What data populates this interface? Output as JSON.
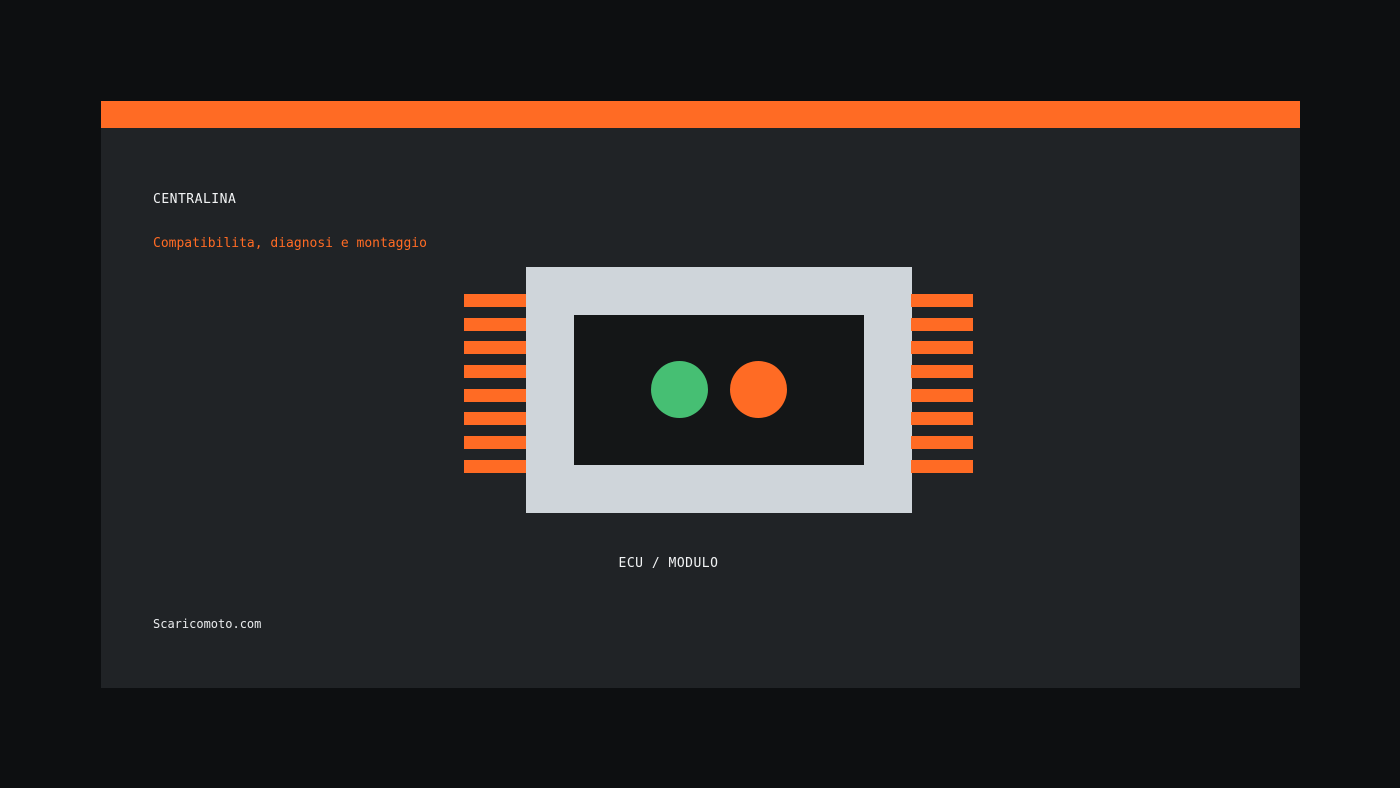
{
  "card": {
    "title": "CENTRALINA",
    "subtitle": "Compatibilita, diagnosi e montaggio"
  },
  "illustration": {
    "caption": "ECU / MODULO",
    "pins_per_side": 8,
    "leds": [
      {
        "name": "green-led",
        "color": "#46bf73"
      },
      {
        "name": "orange-led",
        "color": "#ff6b24"
      }
    ]
  },
  "footer": {
    "site": "Scaricomoto.com"
  },
  "colors": {
    "accent": "#ff6b24",
    "card_background": "#202326",
    "page_background": "#0d0f11",
    "chip_body": "#cfd5da",
    "chip_screen": "#141617"
  }
}
